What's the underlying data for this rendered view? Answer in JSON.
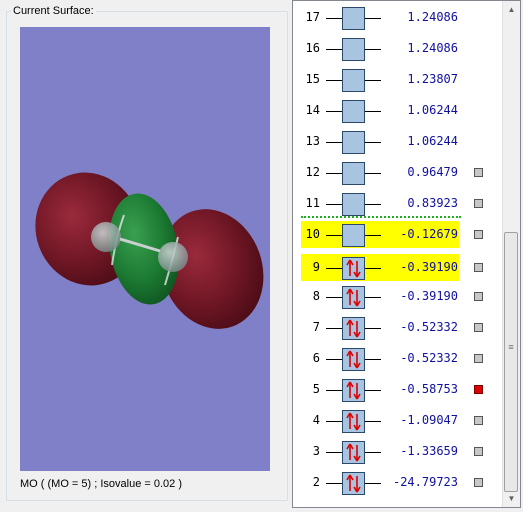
{
  "group": {
    "title": "Current Surface:"
  },
  "status": {
    "caption": "MO ( (MO = 5) ; Isovalue = 0.02 )"
  },
  "orbitals": [
    {
      "num": "17",
      "energy": "1.24086",
      "occupied": false,
      "checkbox": false,
      "highlight": false
    },
    {
      "num": "16",
      "energy": "1.24086",
      "occupied": false,
      "checkbox": false,
      "highlight": false
    },
    {
      "num": "15",
      "energy": "1.23807",
      "occupied": false,
      "checkbox": false,
      "highlight": false
    },
    {
      "num": "14",
      "energy": "1.06244",
      "occupied": false,
      "checkbox": false,
      "highlight": false
    },
    {
      "num": "13",
      "energy": "1.06244",
      "occupied": false,
      "checkbox": false,
      "highlight": false
    },
    {
      "num": "12",
      "energy": "0.96479",
      "occupied": false,
      "checkbox": true,
      "checked": false,
      "highlight": false
    },
    {
      "num": "11",
      "energy": "0.83923",
      "occupied": false,
      "checkbox": true,
      "checked": false,
      "highlight": false
    },
    {
      "num": "10",
      "energy": "-0.12679",
      "occupied": false,
      "checkbox": true,
      "checked": false,
      "highlight": true
    },
    {
      "num": "9",
      "energy": "-0.39190",
      "occupied": true,
      "checkbox": true,
      "checked": false,
      "highlight": true
    },
    {
      "num": "8",
      "energy": "-0.39190",
      "occupied": true,
      "checkbox": true,
      "checked": false,
      "highlight": false
    },
    {
      "num": "7",
      "energy": "-0.52332",
      "occupied": true,
      "checkbox": true,
      "checked": false,
      "highlight": false
    },
    {
      "num": "6",
      "energy": "-0.52332",
      "occupied": true,
      "checkbox": true,
      "checked": false,
      "highlight": false
    },
    {
      "num": "5",
      "energy": "-0.58753",
      "occupied": true,
      "checkbox": true,
      "checked": true,
      "highlight": false
    },
    {
      "num": "4",
      "energy": "-1.09047",
      "occupied": true,
      "checkbox": true,
      "checked": false,
      "highlight": false
    },
    {
      "num": "3",
      "energy": "-1.33659",
      "occupied": true,
      "checkbox": true,
      "checked": false,
      "highlight": false
    },
    {
      "num": "2",
      "energy": "-24.79723",
      "occupied": true,
      "checkbox": true,
      "checked": false,
      "highlight": false
    }
  ],
  "colors": {
    "viewport_bg": "#8080c8",
    "highlight": "#ffff00",
    "energy_text": "#1010a0",
    "homo_lumo_divider": "#20b020",
    "checked_surface": "#e00000",
    "positive_lobe": "#7a1a2a",
    "negative_lobe": "#1f7a32"
  },
  "icons": {
    "electron_pair": "up-down-arrows-icon",
    "scroll_up": "scroll-up-arrow-icon",
    "scroll_down": "scroll-down-arrow-icon"
  }
}
